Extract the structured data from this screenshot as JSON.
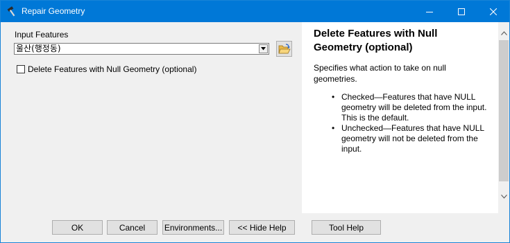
{
  "window": {
    "title": "Repair Geometry",
    "title_icon": "hammer-icon",
    "accent_color": "#0078d7"
  },
  "form": {
    "input_features_label": "Input Features",
    "input_features_value": "울산(행정동)",
    "browse_icon": "open-folder-icon",
    "delete_null_label": "Delete Features with Null Geometry (optional)",
    "delete_null_checked": false
  },
  "help": {
    "title": "Delete Features with Null Geometry (optional)",
    "description": "Specifies what action to take on null geometries.",
    "items": [
      "Checked—Features that have NULL geometry will be deleted from the input. This is the default.",
      "Unchecked—Features that have NULL geometry will not be deleted from the input."
    ]
  },
  "buttons": {
    "ok": "OK",
    "cancel": "Cancel",
    "environments": "Environments...",
    "hide_help": "<< Hide Help",
    "tool_help": "Tool Help"
  }
}
